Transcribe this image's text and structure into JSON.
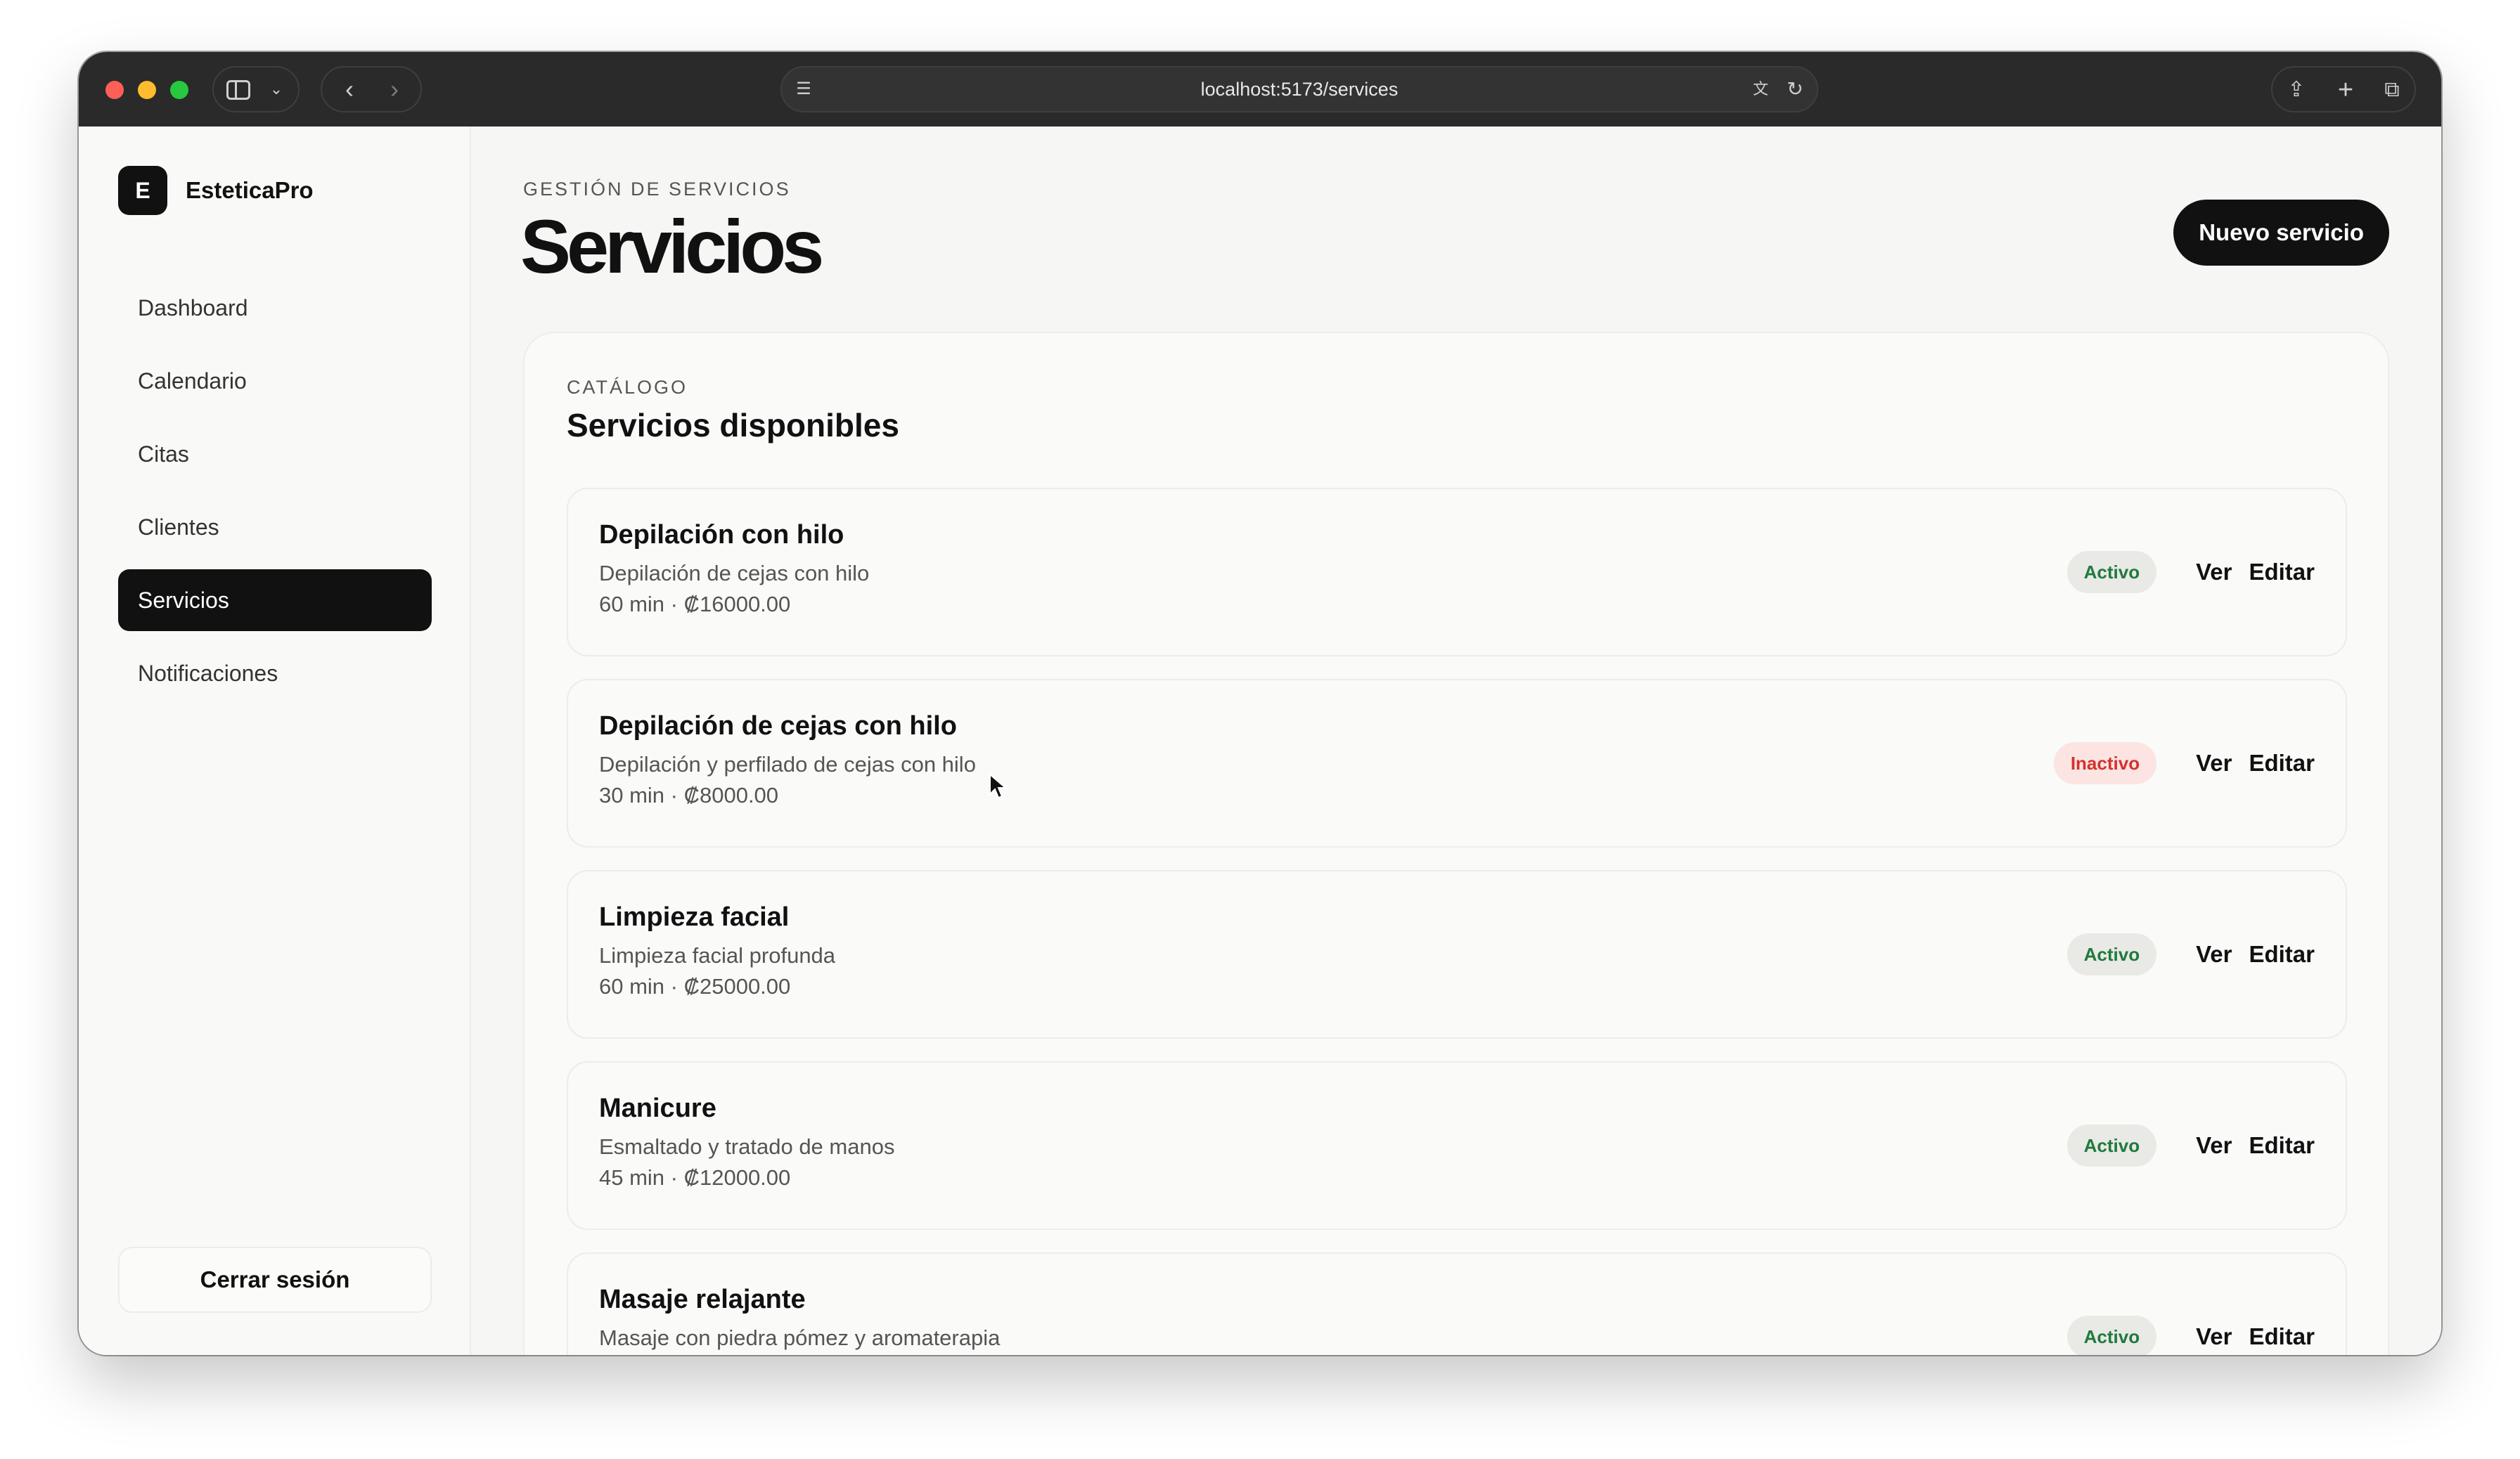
{
  "browser": {
    "url": "localhost:5173/services"
  },
  "sidebar": {
    "brand_initial": "E",
    "brand_name": "EsteticaPro",
    "items": [
      {
        "label": "Dashboard",
        "active": false
      },
      {
        "label": "Calendario",
        "active": false
      },
      {
        "label": "Citas",
        "active": false
      },
      {
        "label": "Clientes",
        "active": false
      },
      {
        "label": "Servicios",
        "active": true
      },
      {
        "label": "Notificaciones",
        "active": false
      }
    ],
    "logout_label": "Cerrar sesión"
  },
  "header": {
    "eyebrow": "GESTIÓN DE SERVICIOS",
    "title": "Servicios",
    "new_button": "Nuevo servicio"
  },
  "catalog": {
    "eyebrow": "CATÁLOGO",
    "title": "Servicios disponibles",
    "services": [
      {
        "name": "Depilación con hilo",
        "description": "Depilación de cejas con hilo",
        "meta": "60 min · ₡16000.00",
        "status": "Activo",
        "status_type": "active",
        "view": "Ver",
        "edit": "Editar"
      },
      {
        "name": "Depilación de cejas con hilo",
        "description": "Depilación y perfilado de cejas con hilo",
        "meta": "30 min · ₡8000.00",
        "status": "Inactivo",
        "status_type": "inactive",
        "view": "Ver",
        "edit": "Editar"
      },
      {
        "name": "Limpieza facial",
        "description": "Limpieza facial profunda",
        "meta": "60 min · ₡25000.00",
        "status": "Activo",
        "status_type": "active",
        "view": "Ver",
        "edit": "Editar"
      },
      {
        "name": "Manicure",
        "description": "Esmaltado y tratado de manos",
        "meta": "45 min · ₡12000.00",
        "status": "Activo",
        "status_type": "active",
        "view": "Ver",
        "edit": "Editar"
      },
      {
        "name": "Masaje relajante",
        "description": "Masaje con piedra pómez y aromaterapia",
        "meta": "",
        "status": "Activo",
        "status_type": "active",
        "view": "Ver",
        "edit": "Editar"
      }
    ]
  },
  "colors": {
    "accent": "#111111",
    "active_text": "#1f7a3d",
    "inactive_text": "#d4322c"
  }
}
